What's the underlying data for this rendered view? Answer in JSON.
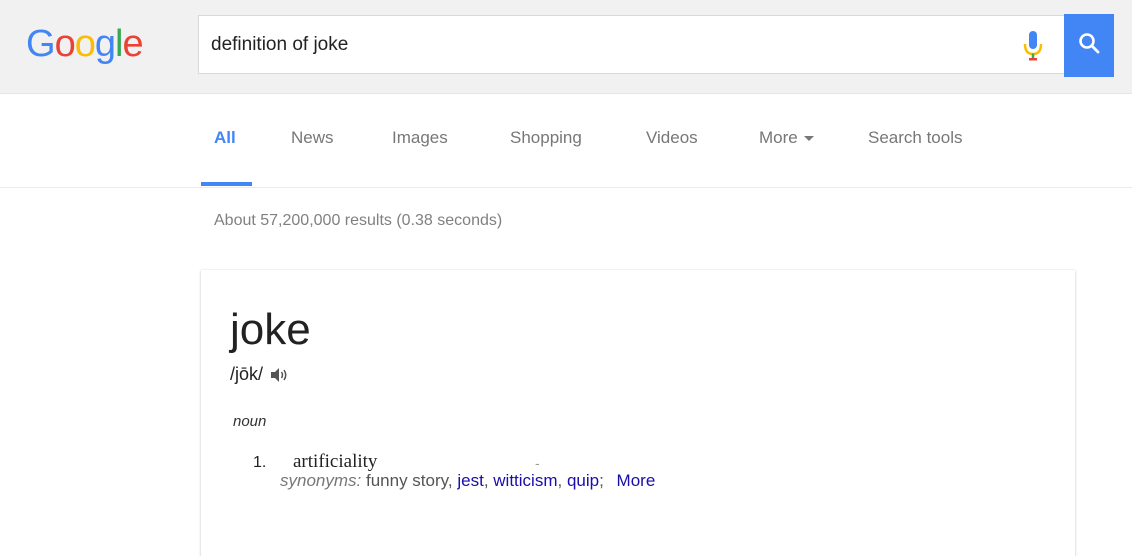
{
  "header": {
    "logo_letters": [
      {
        "char": "G",
        "color": "#4285f4"
      },
      {
        "char": "o",
        "color": "#ea4335"
      },
      {
        "char": "o",
        "color": "#fbbc05"
      },
      {
        "char": "g",
        "color": "#4285f4"
      },
      {
        "char": "l",
        "color": "#34a853"
      },
      {
        "char": "e",
        "color": "#ea4335"
      }
    ],
    "query": "definition of joke",
    "mic_icon": "microphone-icon",
    "search_icon": "search-icon",
    "accent_color": "#4285f4"
  },
  "tabs": {
    "items": [
      {
        "label": "All",
        "active": true
      },
      {
        "label": "News",
        "active": false
      },
      {
        "label": "Images",
        "active": false
      },
      {
        "label": "Shopping",
        "active": false
      },
      {
        "label": "Videos",
        "active": false
      },
      {
        "label": "More",
        "active": false
      },
      {
        "label": "Search tools",
        "active": false
      }
    ]
  },
  "result_stats": "About 57,200,000 results (0.38 seconds)",
  "dictionary": {
    "word": "joke",
    "pronunciation": "/jōk/",
    "speaker_icon": "speaker-icon",
    "part_of_speech": "noun",
    "definitions": [
      {
        "number": "1.",
        "text": "artificiality",
        "dash": "-",
        "synonyms_label": "synonyms:",
        "synonyms_plain": "funny story,",
        "synonym_links": [
          "jest",
          "witticism",
          "quip"
        ],
        "more_label": "More"
      }
    ]
  }
}
